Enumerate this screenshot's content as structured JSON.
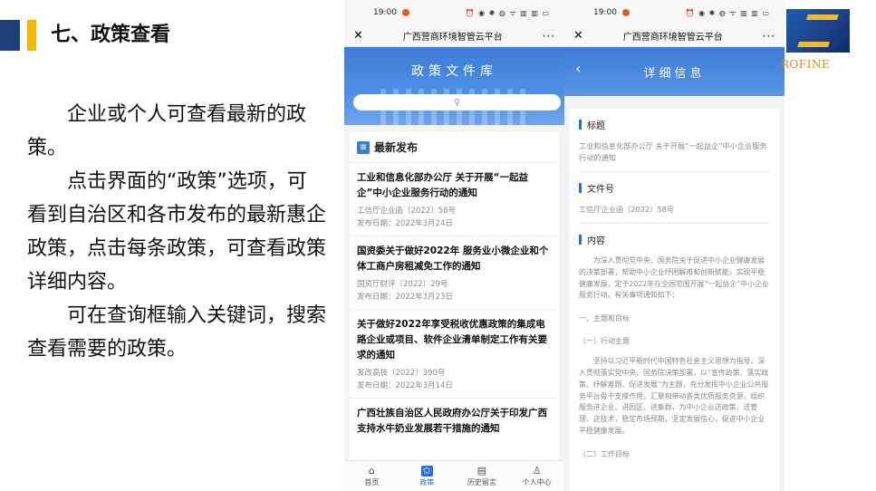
{
  "slide": {
    "title": "七、政策查看",
    "paragraphs": [
      "企业或个人可查看最新的政策。",
      "点击界面的“政策”选项，可看到自治区和各市发布的最新惠企政策，点击每条政策，可查看政策详细内容。",
      "可在查询框输入关键词，搜索查看需要的政策。"
    ]
  },
  "phone1": {
    "time": "19:00",
    "status_icons": "⏰ ◉ ✱ ◍ ᯤ ▥ ▥ ▭",
    "app_title": "广西营商环境智管云平台",
    "close_icon": "✕",
    "more_icon": "···",
    "banner_title": "政策文件库",
    "search_icon": "⚲",
    "section_title": "最新发布",
    "news": [
      {
        "title": "工业和信息化部办公厅 关于开展“一起益企”中小企业服务行动的通知",
        "doc_no": "工信厅企业函〔2022〕58号",
        "date": "发布日期：2022年3月24日"
      },
      {
        "title": "国资委关于做好2022年 服务业小微企业和个体工商户房租减免工作的通知",
        "doc_no": "国资厅财评〔2022〕29号",
        "date": "发布日期：2022年3月23日"
      },
      {
        "title": "关于做好2022年享受税收优惠政策的集成电路企业或项目、软件企业清单制定工作有关要求的通知",
        "doc_no": "发改高技〔2022〕390号",
        "date": "发布日期：2022年3月14日"
      },
      {
        "title": "广西壮族自治区人民政府办公厅关于印发广西支持水牛奶业发展若干措施的通知",
        "doc_no": "",
        "date": ""
      }
    ],
    "tabs": [
      {
        "icon": "⌂",
        "label": "首页"
      },
      {
        "icon": "✩",
        "label": "政策"
      },
      {
        "icon": "▤",
        "label": "历史留言"
      },
      {
        "icon": "♙",
        "label": "个人中心"
      }
    ]
  },
  "phone2": {
    "time": "19:00",
    "status_icons": "⏰ ◉ ✱ ◍ ᯤ ▥ ▥ ▭",
    "app_title": "广西营商环境智管云平台",
    "close_icon": "✕",
    "more_icon": "···",
    "back_icon": "‹",
    "banner_title": "详细信息",
    "label_title": "标题",
    "title_value": "工业和信息化部办公厅 关于开展“一起益企”中小企业服务行动的通知",
    "label_doc": "文件号",
    "doc_value": "工信厅企业函〔2022〕58号",
    "label_content": "内容",
    "content_para": "为深入贯彻党中央、国务院关于促进中小企业健康发展的决策部署，帮助中小企业纾困解难和创新赋能，实现平稳健康发展，定于2022年在全国范围开展“一起益企”中小企业服务行动。有关事项通知如下：",
    "heading1": "一、主题和目标",
    "heading2": "（一）行动主题",
    "body_para": "坚持以习近平新时代中国特色社会主义思想为指导，深入贯彻落实党中央、国务院决策部署，以“宣传政策、落实政策、纾解难题、促进发展”为主题，充分发挥中小企业公共服务平台骨干支撑作用，汇聚和带动各类优质服务资源，组织服务进企业、进园区、进集群，为中小企业送政策、送管理、送技术，稳定市场预期，坚定发展信心，促进中小企业平稳健康发展。",
    "heading3": "（二）工作目标"
  },
  "logo": {
    "text": "ROFINE",
    "colors": {
      "blue": "#1d3f86",
      "gold": "#f1b92f"
    }
  }
}
